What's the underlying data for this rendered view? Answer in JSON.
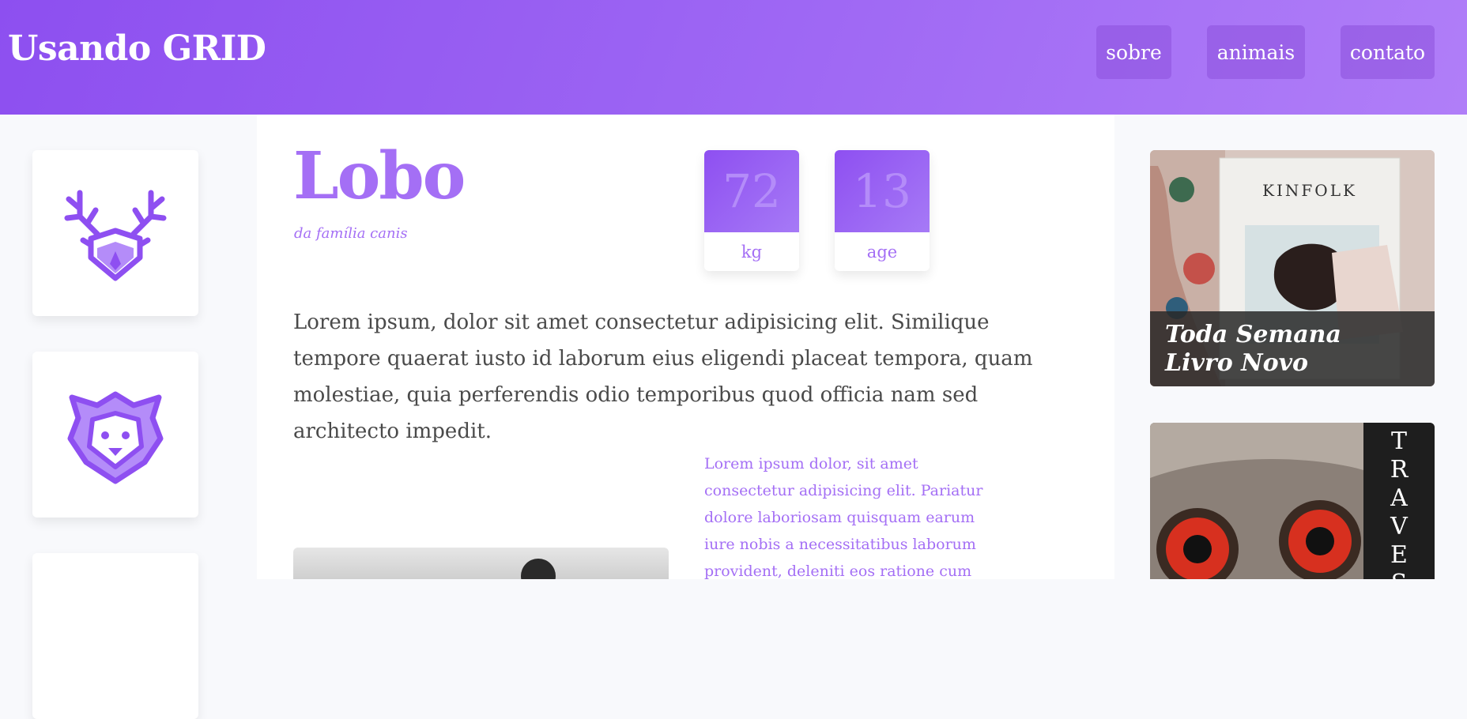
{
  "header": {
    "brand": "Usando GRID",
    "nav": [
      {
        "label": "sobre"
      },
      {
        "label": "animais"
      },
      {
        "label": "contato"
      }
    ]
  },
  "left_icons": [
    {
      "icon": "deer-icon"
    },
    {
      "icon": "lion-icon"
    },
    {
      "icon": "animal-icon"
    }
  ],
  "animal": {
    "name": "Lobo",
    "family": "da família canis",
    "stats": [
      {
        "value": "72",
        "label": "kg"
      },
      {
        "value": "13",
        "label": "age"
      }
    ],
    "description": "Lorem ipsum, dolor sit amet consectetur adipisicing elit. Similique tempore quaerat iusto id laborum eius eligendi placeat tempora, quam molestiae, quia perferendis odio temporibus quod officia nam sed architecto impedit.",
    "side_note": "Lorem ipsum dolor, sit amet consectetur adipisicing elit. Pariatur dolore laboriosam quisquam earum iure nobis a necessitatibus laborum provident, deleniti eos ratione cum"
  },
  "promos": [
    {
      "cover_text": "KINFOLK",
      "caption_line1": "Toda Semana",
      "caption_line2": "Livro Novo"
    },
    {
      "vertical_text": [
        "T",
        "R",
        "A",
        "V",
        "E",
        "S"
      ]
    }
  ],
  "colors": {
    "accent": "#a46ff5",
    "header_start": "#8d4ff0",
    "header_end": "#b07ef8"
  }
}
